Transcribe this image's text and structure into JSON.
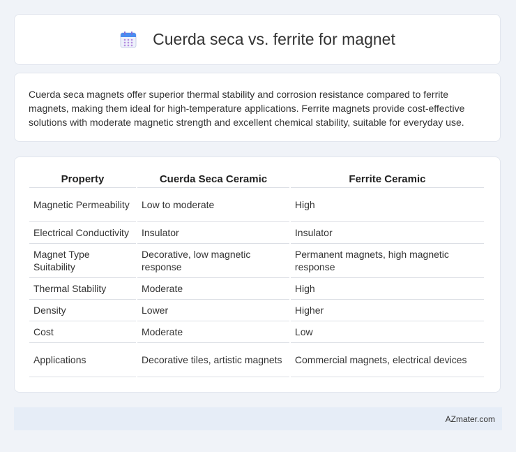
{
  "header": {
    "title": "Cuerda seca vs. ferrite for magnet",
    "icon": "calendar-icon"
  },
  "intro": {
    "text": "Cuerda seca magnets offer superior thermal stability and corrosion resistance compared to ferrite magnets, making them ideal for high-temperature applications. Ferrite magnets provide cost-effective solutions with moderate magnetic strength and excellent chemical stability, suitable for everyday use."
  },
  "table": {
    "headers": [
      "Property",
      "Cuerda Seca Ceramic",
      "Ferrite Ceramic"
    ],
    "rows": [
      [
        "Magnetic Permeability",
        "Low to moderate",
        "High"
      ],
      [
        "Electrical Conductivity",
        "Insulator",
        "Insulator"
      ],
      [
        "Magnet Type Suitability",
        "Decorative, low magnetic response",
        "Permanent magnets, high magnetic response"
      ],
      [
        "Thermal Stability",
        "Moderate",
        "High"
      ],
      [
        "Density",
        "Lower",
        "Higher"
      ],
      [
        "Cost",
        "Moderate",
        "Low"
      ],
      [
        "Applications",
        "Decorative tiles, artistic magnets",
        "Commercial magnets, electrical devices"
      ]
    ]
  },
  "footer": {
    "text": "AZmater.com"
  },
  "colors": {
    "background": "#f0f3f8",
    "card": "#ffffff",
    "footer": "#e6edf7",
    "icon_accent": "#4a8cf0"
  }
}
